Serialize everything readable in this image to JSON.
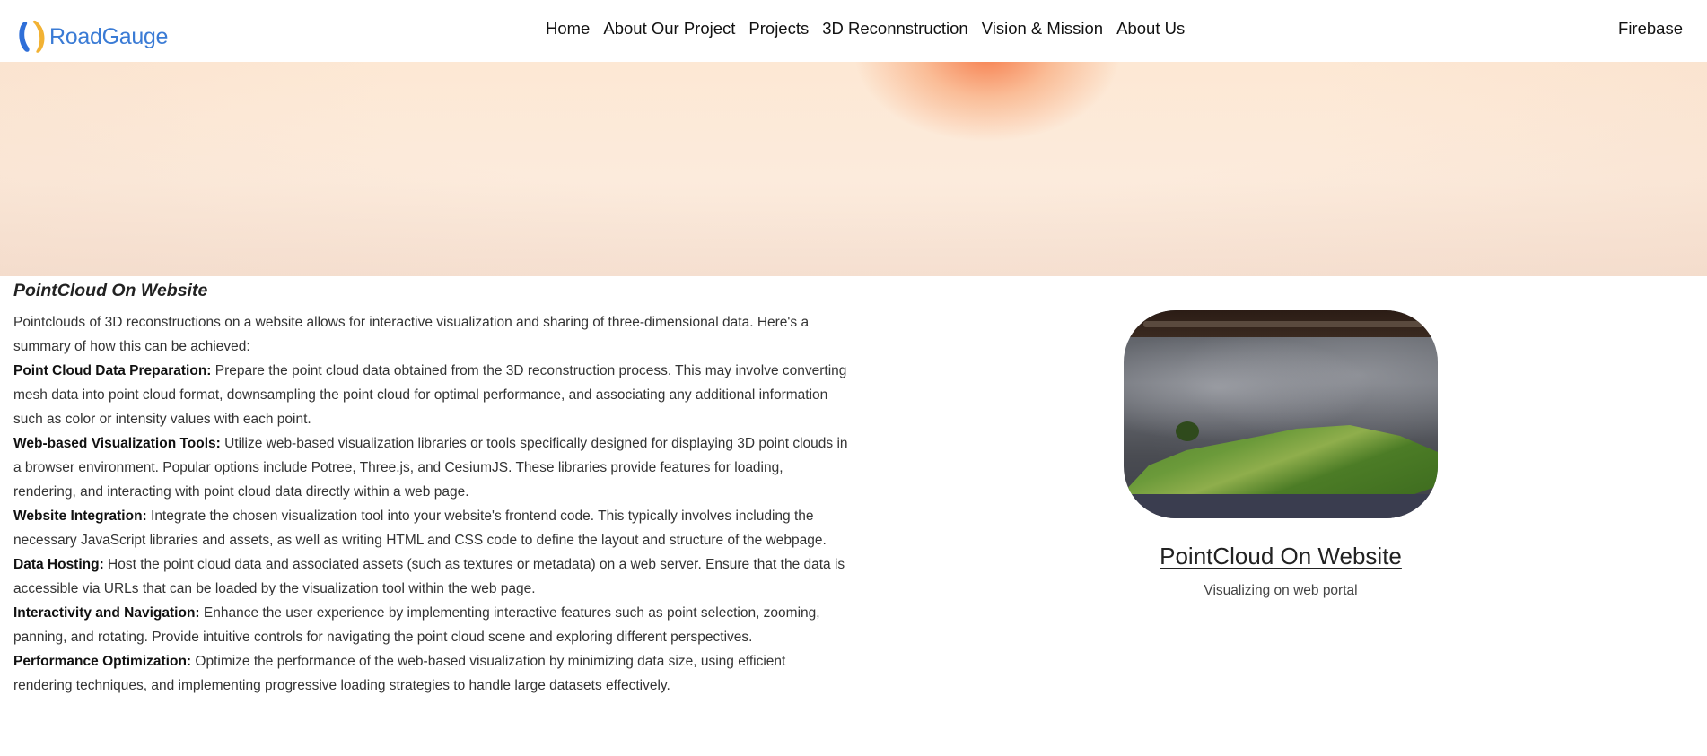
{
  "brand": {
    "name": "RoadGauge",
    "logo_icon": "roadgauge-logo-icon",
    "color": "#3a7bd5"
  },
  "nav": {
    "items": [
      "Home",
      "About Our Project",
      "Projects",
      "3D Reconnstruction",
      "Vision & Mission",
      "About Us"
    ],
    "right_link": "Firebase"
  },
  "hero": {
    "glow_color": "#f67846",
    "background": "#fde8d4"
  },
  "article": {
    "title": "PointCloud On Website",
    "intro": "Pointclouds of 3D reconstructions on a website allows for interactive visualization and sharing of three-dimensional data. Here's a summary of how this can be achieved:",
    "sections": [
      {
        "heading": "Point Cloud Data Preparation:",
        "text": " Prepare the point cloud data obtained from the 3D reconstruction process. This may involve converting mesh data into point cloud format, downsampling the point cloud for optimal performance, and associating any additional information such as color or intensity values with each point."
      },
      {
        "heading": "Web-based Visualization Tools:",
        "text": " Utilize web-based visualization libraries or tools specifically designed for displaying 3D point clouds in a browser environment. Popular options include Potree, Three.js, and CesiumJS. These libraries provide features for loading, rendering, and interacting with point cloud data directly within a web page."
      },
      {
        "heading": "Website Integration:",
        "text": " Integrate the chosen visualization tool into your website's frontend code. This typically involves including the necessary JavaScript libraries and assets, as well as writing HTML and CSS code to define the layout and structure of the webpage."
      },
      {
        "heading": "Data Hosting:",
        "text": " Host the point cloud data and associated assets (such as textures or metadata) on a web server. Ensure that the data is accessible via URLs that can be loaded by the visualization tool within the web page."
      },
      {
        "heading": "Interactivity and Navigation:",
        "text": " Enhance the user experience by implementing interactive features such as point selection, zooming, panning, and rotating. Provide intuitive controls for navigating the point cloud scene and exploring different perspectives."
      },
      {
        "heading": "Performance Optimization:",
        "text": " Optimize the performance of the web-based visualization by minimizing data size, using efficient rendering techniques, and implementing progressive loading strategies to handle large datasets effectively."
      }
    ]
  },
  "card": {
    "link": "PointCloud On Website",
    "caption": "Visualizing on web portal"
  }
}
